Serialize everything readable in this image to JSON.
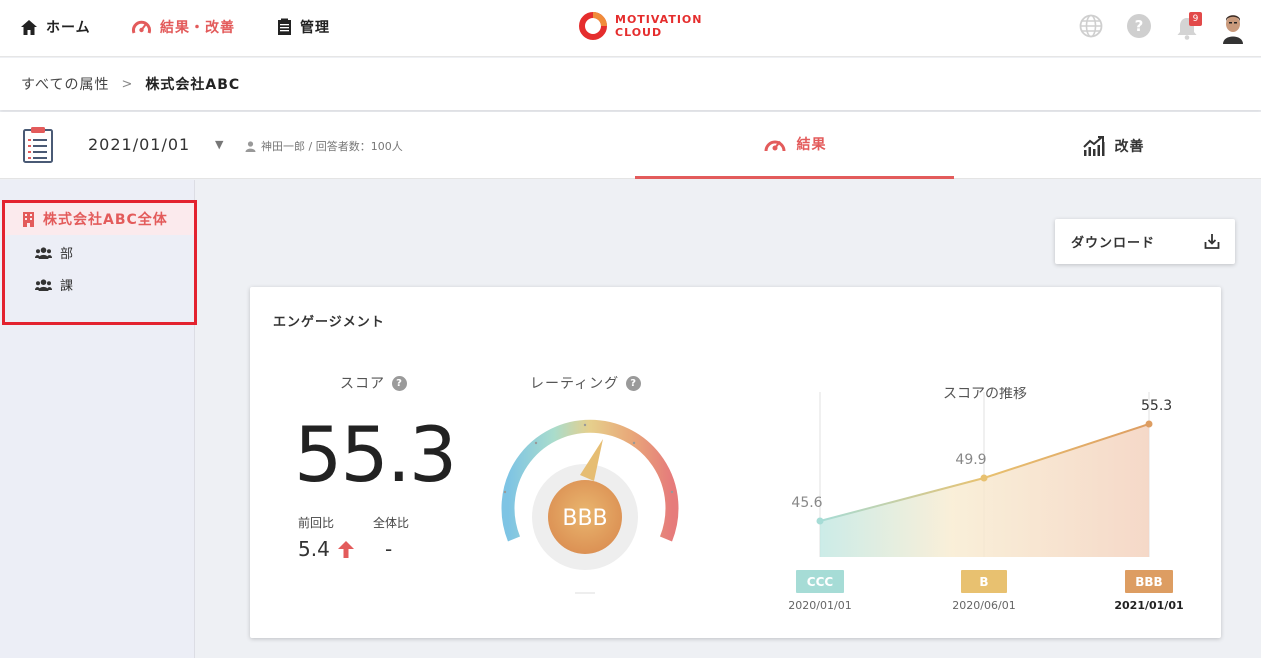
{
  "nav": {
    "home": "ホーム",
    "results": "結果・改善",
    "manage": "管理",
    "logo_line1": "MOTIVATION",
    "logo_line2": "CLOUD",
    "notification_count": "9"
  },
  "breadcrumb": {
    "root": "すべての属性",
    "separator": ">",
    "current": "株式会社ABC"
  },
  "subheader": {
    "date": "2021/01/01",
    "meta": "神田一郎 / 回答者数：100人",
    "tab_results": "結果",
    "tab_improve": "改善"
  },
  "sidebar": {
    "root": "株式会社ABC全体",
    "items": [
      {
        "label": "部"
      },
      {
        "label": "課"
      }
    ]
  },
  "download": {
    "label": "ダウンロード"
  },
  "engagement": {
    "title": "エンゲージメント",
    "score_label": "スコア",
    "rating_label": "レーティング",
    "trend_label": "スコアの推移",
    "help": "?",
    "score": "55.3",
    "prev_label": "前回比",
    "total_label": "全体比",
    "prev_value": "5.4",
    "total_value": "-",
    "rating": "BBB"
  },
  "chart_data": {
    "type": "area",
    "title": "スコアの推移",
    "x": [
      "2020/01/01",
      "2020/06/01",
      "2021/01/01"
    ],
    "values": [
      45.6,
      49.9,
      55.3
    ],
    "ratings": [
      "CCC",
      "B",
      "BBB"
    ],
    "rating_colors": [
      "#a6dcd6",
      "#e8c170",
      "#dd9d62"
    ]
  },
  "colors": {
    "accent": "#e35b5b",
    "highlight_box": "#e3222f"
  }
}
